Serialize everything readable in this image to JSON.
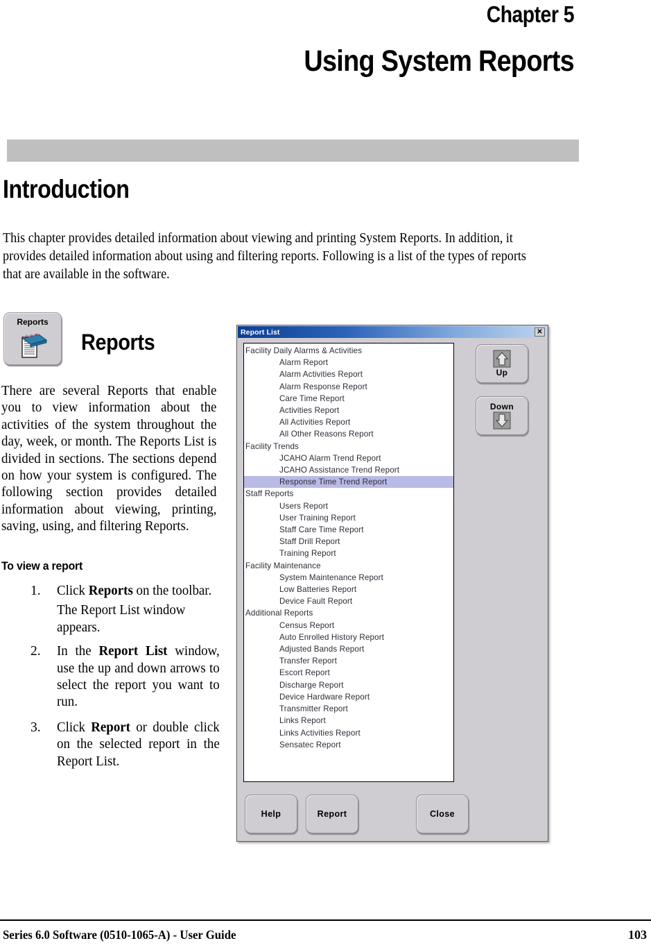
{
  "page": {
    "chapter_number": "Chapter 5",
    "chapter_title": "Using System Reports",
    "section_title": "Introduction",
    "intro_paragraph": "This chapter provides detailed information about viewing and printing System Reports. In addition, it provides detailed information about using and filtering reports. Following is a list of the types of reports that are available in the software."
  },
  "reports_block": {
    "toolbar_button_label": "Reports",
    "toolbar_button_icon": "notepad-icon",
    "heading": "Reports",
    "paragraph": "There are several Reports that enable you to view information about the activities of the system throughout the day, week, or month. The Reports List is divided in sections. The sections depend on how your system is configured. The following section provides detailed information about viewing, printing, saving, using, and filtering Reports.",
    "procedure_heading": "To view a report",
    "steps": [
      {
        "number": "1.",
        "text_parts": [
          "Click ",
          "Reports",
          " on the toolbar."
        ],
        "sub_text": "The Report List window appears."
      },
      {
        "number": "2.",
        "text_parts": [
          "In the ",
          "Report List",
          " window, use the up and down arrows to select the report you want to run."
        ],
        "sub_text": ""
      },
      {
        "number": "3.",
        "text_parts": [
          "Click ",
          "Report",
          " or double click on the selected report in the Report List."
        ],
        "sub_text": ""
      }
    ]
  },
  "dialog": {
    "title": "Report List",
    "close_glyph": "✕",
    "selected_item": "Response Time Trend Report",
    "list": [
      {
        "label": "Facility Daily Alarms & Activities",
        "type": "group"
      },
      {
        "label": "Alarm Report",
        "type": "item"
      },
      {
        "label": "Alarm Activities Report",
        "type": "item"
      },
      {
        "label": "Alarm Response Report",
        "type": "item"
      },
      {
        "label": "Care Time Report",
        "type": "item"
      },
      {
        "label": "Activities Report",
        "type": "item"
      },
      {
        "label": "All Activities Report",
        "type": "item"
      },
      {
        "label": "All Other Reasons Report",
        "type": "item"
      },
      {
        "label": "Facility Trends",
        "type": "group"
      },
      {
        "label": "JCAHO Alarm Trend Report",
        "type": "item"
      },
      {
        "label": "JCAHO Assistance Trend Report",
        "type": "item"
      },
      {
        "label": "Response Time Trend Report",
        "type": "item",
        "selected": true
      },
      {
        "label": "Staff Reports",
        "type": "group"
      },
      {
        "label": "Users Report",
        "type": "item"
      },
      {
        "label": "User Training Report",
        "type": "item"
      },
      {
        "label": "Staff Care Time Report",
        "type": "item"
      },
      {
        "label": "Staff Drill Report",
        "type": "item"
      },
      {
        "label": "Training Report",
        "type": "item"
      },
      {
        "label": "Facility Maintenance",
        "type": "group"
      },
      {
        "label": "System Maintenance Report",
        "type": "item"
      },
      {
        "label": "Low Batteries Report",
        "type": "item"
      },
      {
        "label": "Device Fault Report",
        "type": "item"
      },
      {
        "label": "Additional Reports",
        "type": "group"
      },
      {
        "label": "Census Report",
        "type": "item"
      },
      {
        "label": "Auto Enrolled History Report",
        "type": "item"
      },
      {
        "label": "Adjusted Bands Report",
        "type": "item"
      },
      {
        "label": "Transfer Report",
        "type": "item"
      },
      {
        "label": "Escort Report",
        "type": "item"
      },
      {
        "label": "Discharge Report",
        "type": "item"
      },
      {
        "label": "Device Hardware Report",
        "type": "item"
      },
      {
        "label": "Transmitter Report",
        "type": "item"
      },
      {
        "label": "Links Report",
        "type": "item"
      },
      {
        "label": "Links Activities Report",
        "type": "item"
      },
      {
        "label": "Sensatec Report",
        "type": "item"
      }
    ],
    "buttons": {
      "up": "Up",
      "down": "Down",
      "help": "Help",
      "report": "Report",
      "close": "Close"
    },
    "colors": {
      "titlebar_start": "#0b3f94",
      "titlebar_end": "#bdd4ef",
      "selection": "#b9bae6",
      "face": "#cfcdd1"
    }
  },
  "footer": {
    "left": "Series 6.0 Software (0510-1065-A) - User Guide",
    "page_number": "103"
  }
}
